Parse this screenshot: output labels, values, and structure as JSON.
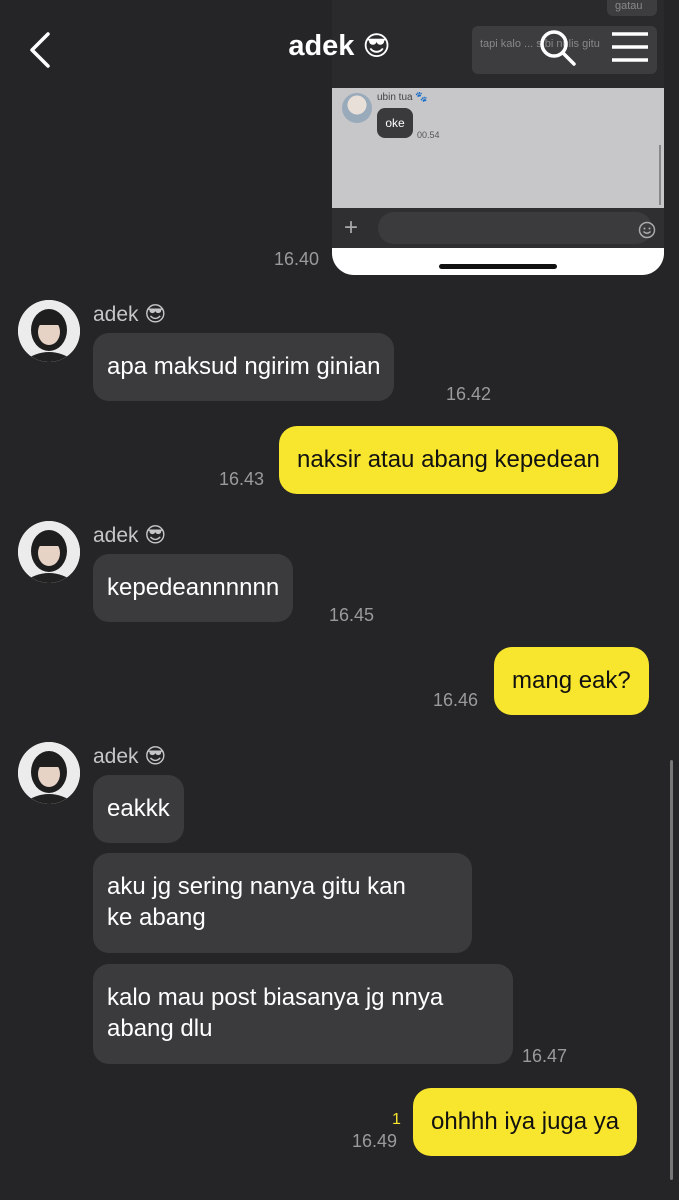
{
  "header": {
    "title": "adek",
    "title_emoji": "😎"
  },
  "shared_screenshot": {
    "top_bubble_a": "gatau",
    "top_bubble_b": "tapi kalo ... s bi nulis gitu",
    "sender_name": "ubin tua 🐾",
    "message": "oke",
    "time": "00.54",
    "plus": "+",
    "hash": "#",
    "sent_time": "16.40"
  },
  "messages": [
    {
      "from": "adek",
      "sender": "adek 😎",
      "lines": [
        "apa maksud ngirim ginian"
      ],
      "time": "16.42"
    },
    {
      "from": "me",
      "lines": [
        "naksir atau abang kepedean"
      ],
      "time": "16.43"
    },
    {
      "from": "adek",
      "sender": "adek 😎",
      "lines": [
        "kepedeannnnnn"
      ],
      "time": "16.45"
    },
    {
      "from": "me",
      "lines": [
        "mang eak?"
      ],
      "time": "16.46"
    },
    {
      "from": "adek",
      "sender": "adek 😎",
      "lines": [
        "eakkk"
      ]
    },
    {
      "from": "adek",
      "lines": [
        "aku jg sering nanya gitu kan",
        "ke abang"
      ]
    },
    {
      "from": "adek",
      "lines": [
        "kalo mau post biasanya jg nnya",
        "abang dlu"
      ],
      "time": "16.47"
    },
    {
      "from": "me",
      "lines": [
        "ohhhh iya juga ya"
      ],
      "time": "16.49",
      "unread": "1"
    }
  ],
  "colors": {
    "background": "#252527",
    "incoming_bubble": "#3b3b3d",
    "outgoing_bubble": "#f7e52e"
  }
}
